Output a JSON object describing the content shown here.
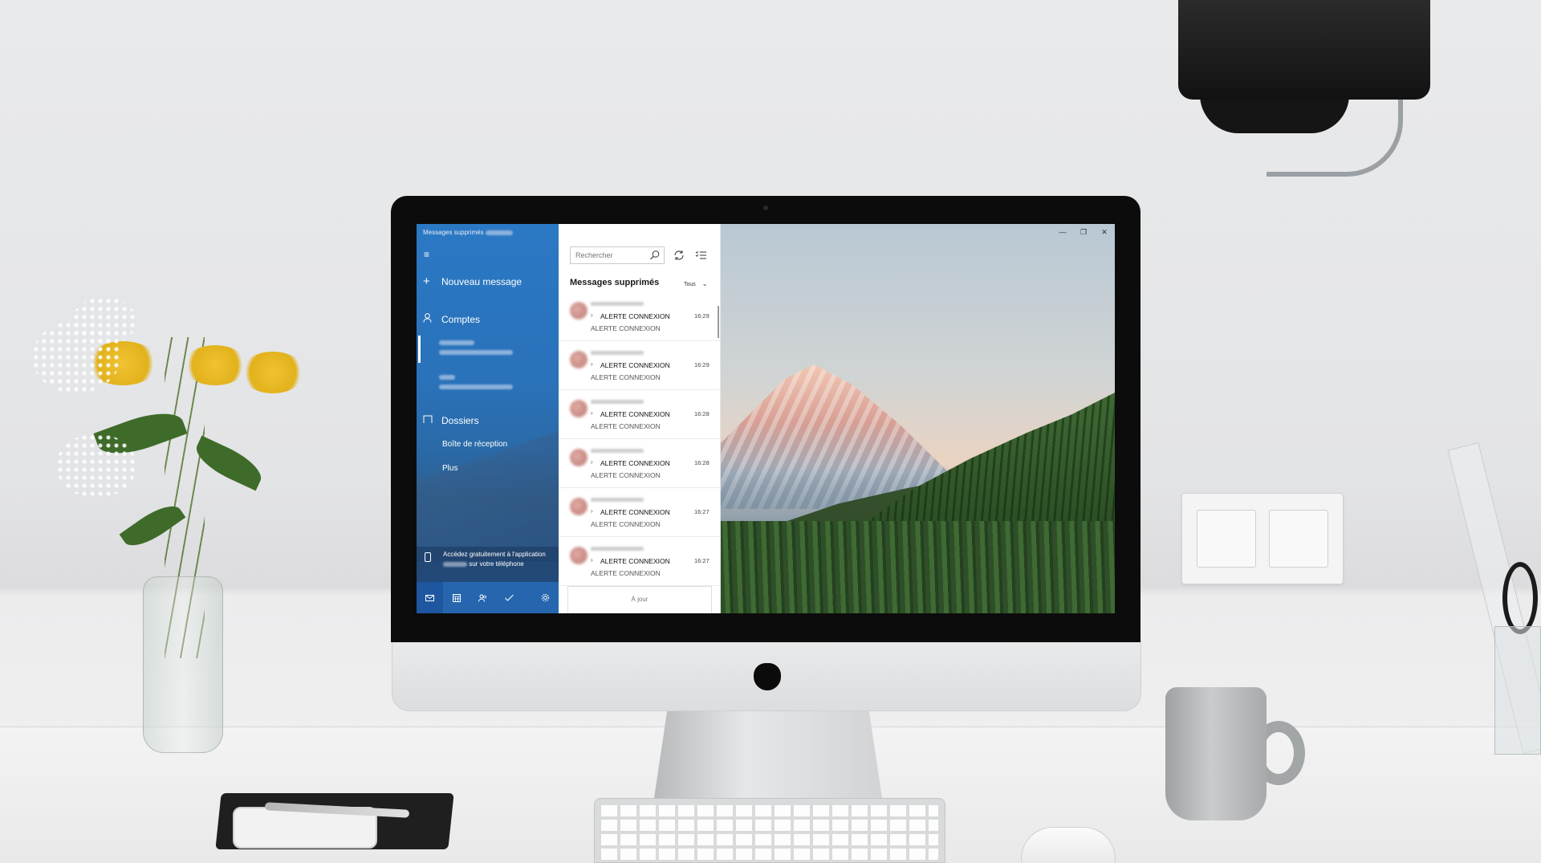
{
  "window": {
    "title": "Messages supprimés",
    "controls": [
      "minimize-icon",
      "restore-icon",
      "close-icon"
    ]
  },
  "nav": {
    "menu_icon": "hamburger-icon",
    "new_message": "Nouveau message",
    "accounts_label": "Comptes",
    "folders_label": "Dossiers",
    "folders": [
      "Boîte de réception",
      "Plus"
    ],
    "promo": {
      "text_before": "Accédez gratuitement à l'application",
      "text_after": "sur votre téléphone"
    },
    "bottom_bar": [
      "mail-icon",
      "calendar-icon",
      "people-icon",
      "todo-icon",
      "settings-icon"
    ],
    "accent": "#2b78c4"
  },
  "list": {
    "search_placeholder": "Rechercher",
    "folder_title": "Messages supprimés",
    "filter": "Tous",
    "messages": [
      {
        "subject": "ALERTE CONNEXION",
        "time": "16:29",
        "preview": "ALERTE CONNEXION"
      },
      {
        "subject": "ALERTE CONNEXION",
        "time": "16:29",
        "preview": "ALERTE CONNEXION"
      },
      {
        "subject": "ALERTE CONNEXION",
        "time": "16:28",
        "preview": "ALERTE CONNEXION"
      },
      {
        "subject": "ALERTE CONNEXION",
        "time": "16:28",
        "preview": "ALERTE CONNEXION"
      },
      {
        "subject": "ALERTE CONNEXION",
        "time": "16:27",
        "preview": "ALERTE CONNEXION"
      },
      {
        "subject": "ALERTE CONNEXION",
        "time": "16:27",
        "preview": "ALERTE CONNEXION"
      }
    ],
    "status": "À jour"
  }
}
